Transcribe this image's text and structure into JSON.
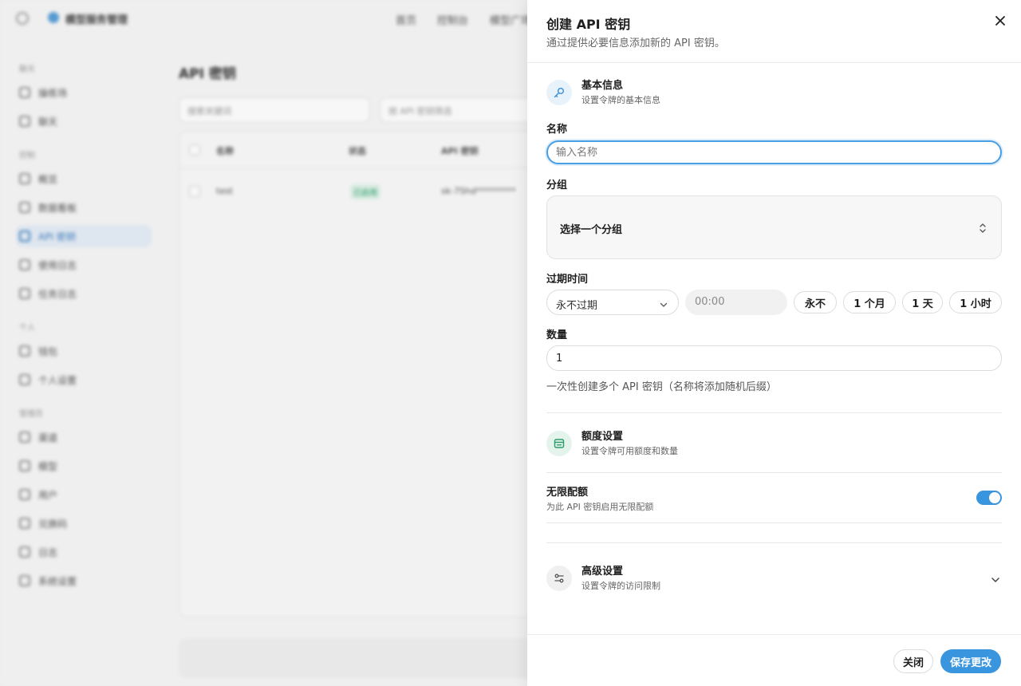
{
  "background": {
    "brand": "模型服务管理",
    "top_nav": [
      "首页",
      "控制台",
      "模型广场"
    ],
    "sidebar": {
      "sections": [
        "聊天",
        "控制",
        "个人",
        "管理员"
      ],
      "items": [
        "操练场",
        "聊天",
        "概览",
        "数据看板",
        "API 密钥",
        "使用日志",
        "任务日志",
        "钱包",
        "个人设置",
        "渠道",
        "模型",
        "用户",
        "兑换码",
        "日志",
        "系统设置"
      ]
    },
    "page_title": "API 密钥",
    "filters": [
      "搜索关键词",
      "按 API 密钥筛选"
    ],
    "table_headers": [
      "名称",
      "状态",
      "API 密钥"
    ],
    "row": {
      "name": "test",
      "status": "已启用",
      "key": "sk-7Shd*********"
    }
  },
  "sheet": {
    "title": "创建 API 密钥",
    "description": "通过提供必要信息添加新的 API 密钥。",
    "basic": {
      "title": "基本信息",
      "subtitle": "设置令牌的基本信息"
    },
    "name_label": "名称",
    "name_placeholder": "输入名称",
    "group_label": "分组",
    "group_placeholder": "选择一个分组",
    "expiry_label": "过期时间",
    "expiry_value": "永不过期",
    "time_placeholder": "00:00",
    "presets": [
      "永不",
      "1 个月",
      "1 天",
      "1 小时"
    ],
    "quantity_label": "数量",
    "quantity_value": "1",
    "quantity_hint": "一次性创建多个 API 密钥（名称将添加随机后缀）",
    "quota": {
      "title": "额度设置",
      "subtitle": "设置令牌可用额度和数量"
    },
    "unlimited": {
      "title": "无限配额",
      "subtitle": "为此 API 密钥启用无限配额",
      "enabled": true
    },
    "advanced": {
      "title": "高级设置",
      "subtitle": "设置令牌的访问限制"
    },
    "close_label": "关闭",
    "save_label": "保存更改"
  },
  "colors": {
    "accent": "#3a95df",
    "quota_icon": "#2a9d6a",
    "key_icon_bg": "#e8f2fb"
  }
}
